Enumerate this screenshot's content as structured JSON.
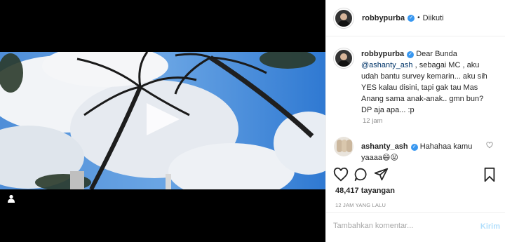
{
  "post": {
    "username": "robbypurba",
    "verified_badge": "verified-icon",
    "separator": "•",
    "follow_status": "Diikuti"
  },
  "caption": {
    "username": "robbypurba",
    "text_pre": "Dear Bunda",
    "mention": "@ashanty_ash",
    "text_post": ", sebagai MC , aku udah bantu survey kemarin... aku sih YES kalau disini, tapi gak tau Mas Anang sama anak-anak.. gmn bun? DP aja apa... :p",
    "time": "12 jam"
  },
  "reply": {
    "username": "ashanty_ash",
    "text": "Hahahaa kamu yaaaa😄😝"
  },
  "stats": {
    "views": "48,417 tayangan",
    "ago": "12 JAM YANG LALU"
  },
  "comment_box": {
    "placeholder": "Tambahkan komentar...",
    "send_label": "Kirim"
  },
  "icons": {
    "like": "heart-icon",
    "comment": "comment-icon",
    "share": "share-icon",
    "save": "bookmark-icon",
    "play": "play-icon",
    "user_tag": "user-tag-icon"
  }
}
